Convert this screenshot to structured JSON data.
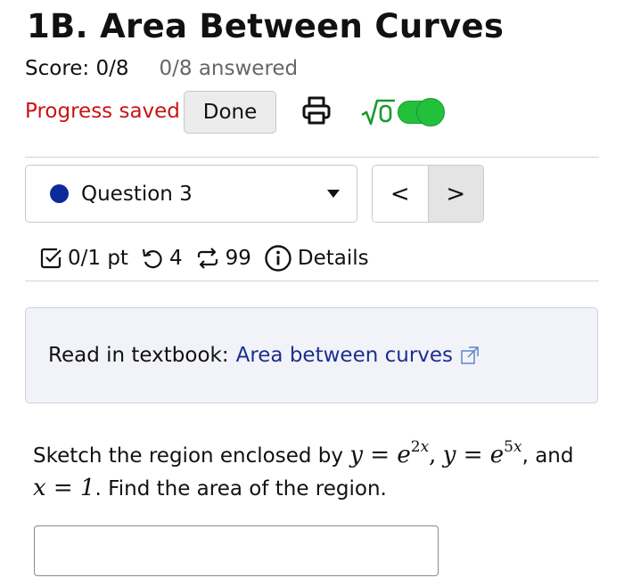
{
  "header": {
    "title": "1B. Area Between Curves",
    "score": "Score: 0/8",
    "answered": "0/8 answered"
  },
  "toolbar": {
    "progress_status": "Progress saved",
    "done_label": "Done",
    "print_icon": "printer-icon",
    "math_icon": "sqrt-icon",
    "math_toggle_on": true,
    "accent_color": "#23c03c",
    "status_color": "#c81414"
  },
  "question_nav": {
    "selected": "Question 3",
    "dot_color": "#0d2a9a",
    "prev_label": "<",
    "next_label": ">"
  },
  "meta": {
    "points": "0/1 pt",
    "attempts": "4",
    "tries": "99",
    "details_label": "Details"
  },
  "textbook": {
    "prefix": "Read in textbook:",
    "link_text": "Area between curves",
    "link_color": "#1c2f8f"
  },
  "question": {
    "intro": "Sketch the region enclosed by",
    "and": ", and",
    "end": ". Find the area of the region.",
    "eq1_lhs": "y",
    "eq1_base": "e",
    "eq1_exp": "2x",
    "eq2_lhs": "y",
    "eq2_base": "e",
    "eq2_exp": "5x",
    "eq3_lhs": "x",
    "eq3_rhs": "1",
    "equals": " = ",
    "comma": ","
  },
  "answer": {
    "value": "",
    "placeholder": ""
  }
}
